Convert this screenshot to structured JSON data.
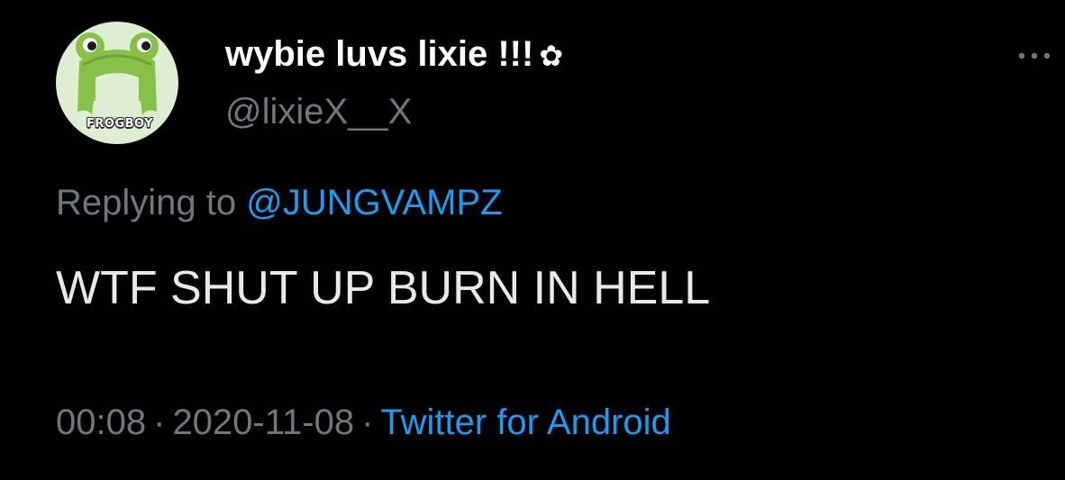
{
  "author": {
    "display_name": "wybie luvs lixie !!!",
    "flower_glyph": "✿",
    "handle": "@lixieX__X",
    "avatar_label": "FROGBOY",
    "avatar_icon": "frog-hat-icon"
  },
  "reply": {
    "prefix": "Replying to",
    "mention": "@JUNGVAMPZ"
  },
  "tweet": {
    "text": "WTF SHUT UP BURN IN HELL"
  },
  "meta": {
    "time": "00:08",
    "separator": "·",
    "date": "2020-11-08",
    "source": "Twitter for Android"
  },
  "menu": {
    "icon": "more-horizontal-icon"
  },
  "colors": {
    "background": "#000000",
    "primary_text": "#e7e9ea",
    "secondary_text": "#71767b",
    "link": "#1d9bf0",
    "avatar_bg": "#dfeed3",
    "frog_green": "#86c24a"
  }
}
